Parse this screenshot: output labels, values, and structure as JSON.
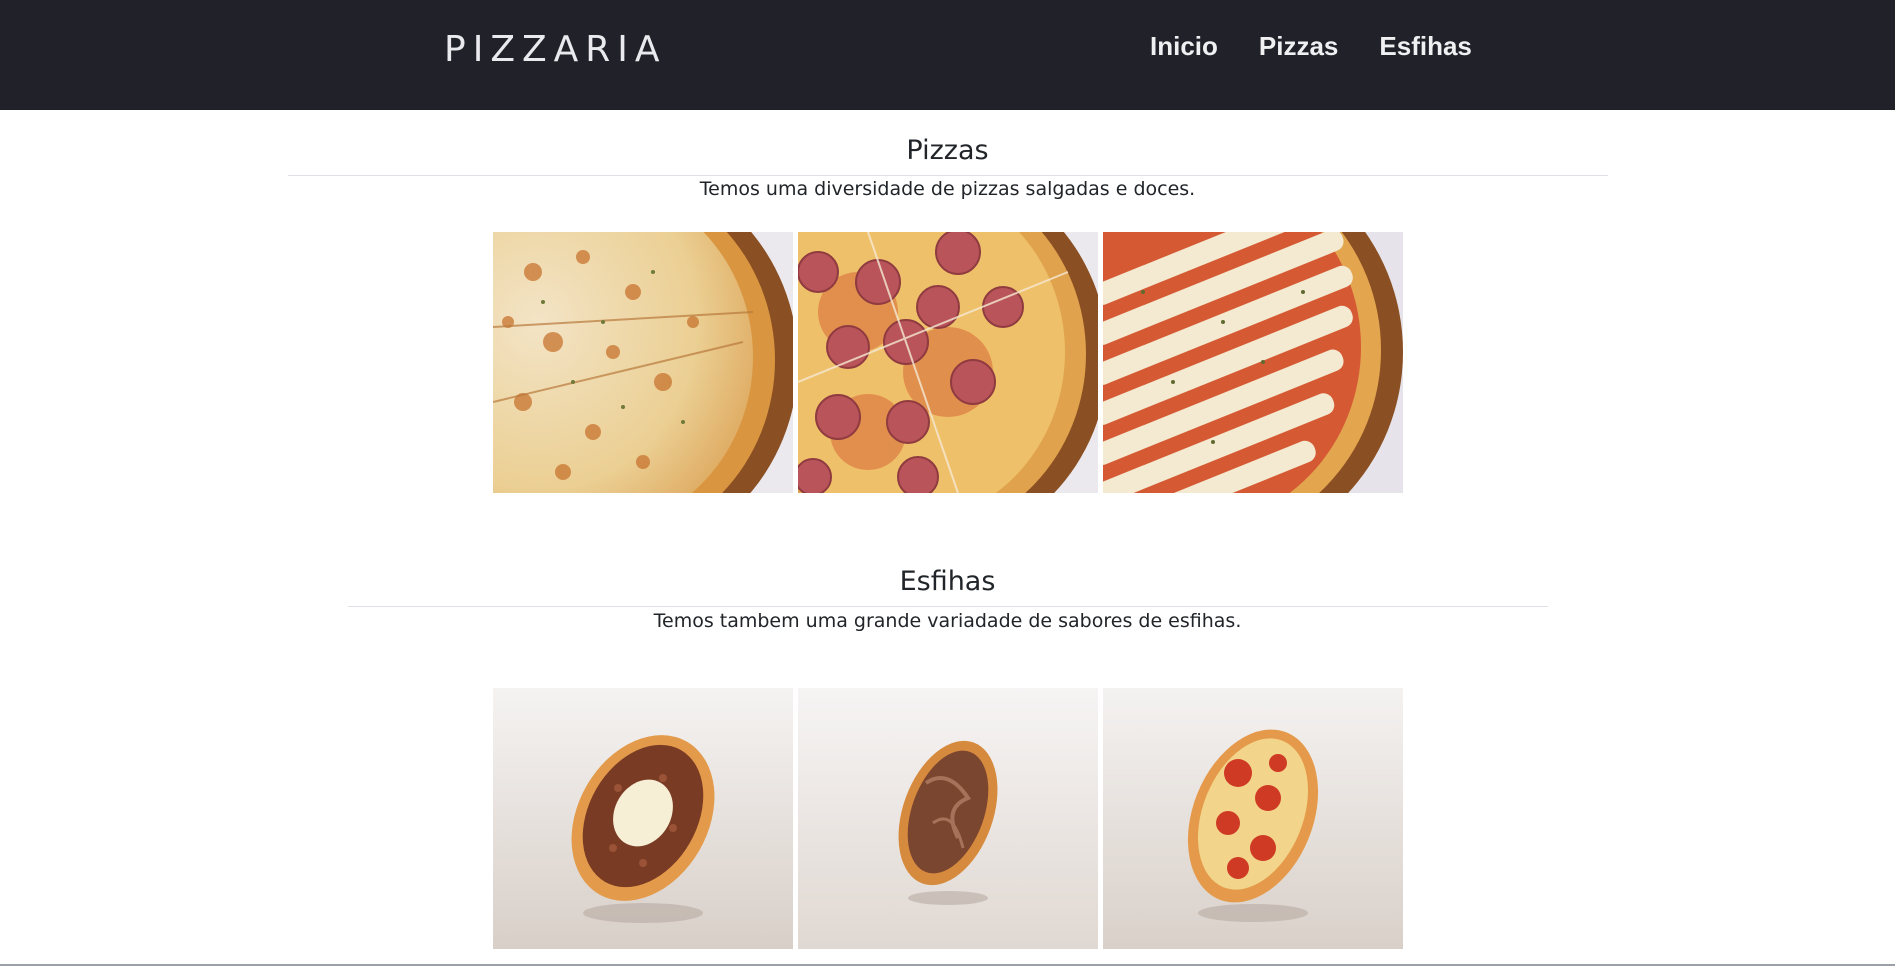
{
  "header": {
    "brand": "PIZZARIA",
    "nav": [
      {
        "label": "Inicio"
      },
      {
        "label": "Pizzas"
      },
      {
        "label": "Esfihas"
      }
    ]
  },
  "sections": {
    "pizzas": {
      "title": "Pizzas",
      "description": "Temos uma diversidade de pizzas salgadas e doces.",
      "images": [
        "pizza-frango-bacon-image",
        "pizza-calabresa-image",
        "pizza-mussarela-image"
      ]
    },
    "esfihas": {
      "title": "Esfihas",
      "description": "Temos tambem uma grande variadade de sabores de esfihas.",
      "images": [
        "esfiha-carne-queijo-image",
        "esfiha-chocolate-image",
        "esfiha-tomate-image"
      ]
    }
  },
  "colors": {
    "navbar_bg": "#212229",
    "nav_text": "#f0f0f2",
    "page_bg": "#ffffff",
    "text": "#212529",
    "rule": "#dee2e6"
  }
}
